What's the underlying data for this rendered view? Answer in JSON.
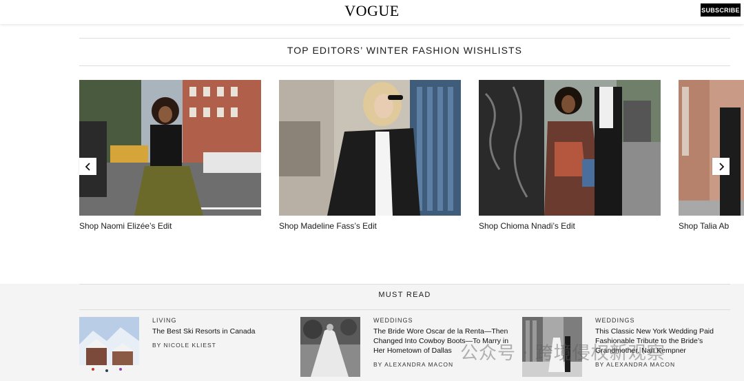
{
  "header": {
    "logo": "VOGUE",
    "subscribe_label": "SUBSCRIBE"
  },
  "wishlists": {
    "title": "TOP EDITORS’ WINTER FASHION WISHLISTS",
    "cards": [
      {
        "caption": "Shop Naomi Elizée’s Edit"
      },
      {
        "caption": "Shop Madeline Fass’s Edit"
      },
      {
        "caption": "Shop Chioma Nnadi’s Edit"
      },
      {
        "caption": "Shop Talia Ab"
      }
    ],
    "prev_icon": "chevron-left-icon",
    "next_icon": "chevron-right-icon"
  },
  "must_read": {
    "title": "MUST READ",
    "items": [
      {
        "category": "LIVING",
        "headline": "The Best Ski Resorts in Canada",
        "byline": "BY NICOLE KLIEST"
      },
      {
        "category": "WEDDINGS",
        "headline": "The Bride Wore Oscar de la Renta—Then Changed Into Cowboy Boots—To Marry in Her Hometown of Dallas",
        "byline": "BY ALEXANDRA MACON"
      },
      {
        "category": "WEDDINGS",
        "headline": "This Classic New York Wedding Paid Fashionable Tribute to the Bride’s Grandmother, Nan Kempner",
        "byline": "BY ALEXANDRA MACON"
      }
    ]
  },
  "watermark": "公众号 · 跨境侵权新观察",
  "colors": {
    "background": "#ffffff",
    "must_read_bg": "#f4f4f4",
    "subscribe_bg": "#000000",
    "text": "#1a1a1a"
  }
}
